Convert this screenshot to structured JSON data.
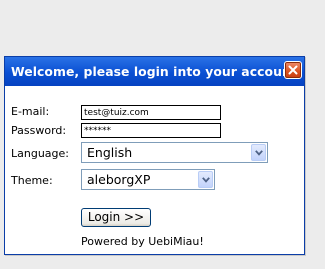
{
  "dialog": {
    "title": "Welcome, please login into your account"
  },
  "form": {
    "email_label": "E-mail:",
    "email_value": "test@tuiz.com",
    "password_label": "Password:",
    "password_masked": "******",
    "language_label": "Language:",
    "language_value": "English",
    "theme_label": "Theme:",
    "theme_value": "aleborgXP",
    "login_button": "Login >>",
    "powered_by": "Powered by UebiMiau!"
  },
  "icons": {
    "close": "close-icon",
    "dropdown": "chevron-down-icon"
  },
  "colors": {
    "title_bar": "#0a4fd3",
    "close_button": "#d9501f",
    "panel_border": "#0b3ea8"
  }
}
